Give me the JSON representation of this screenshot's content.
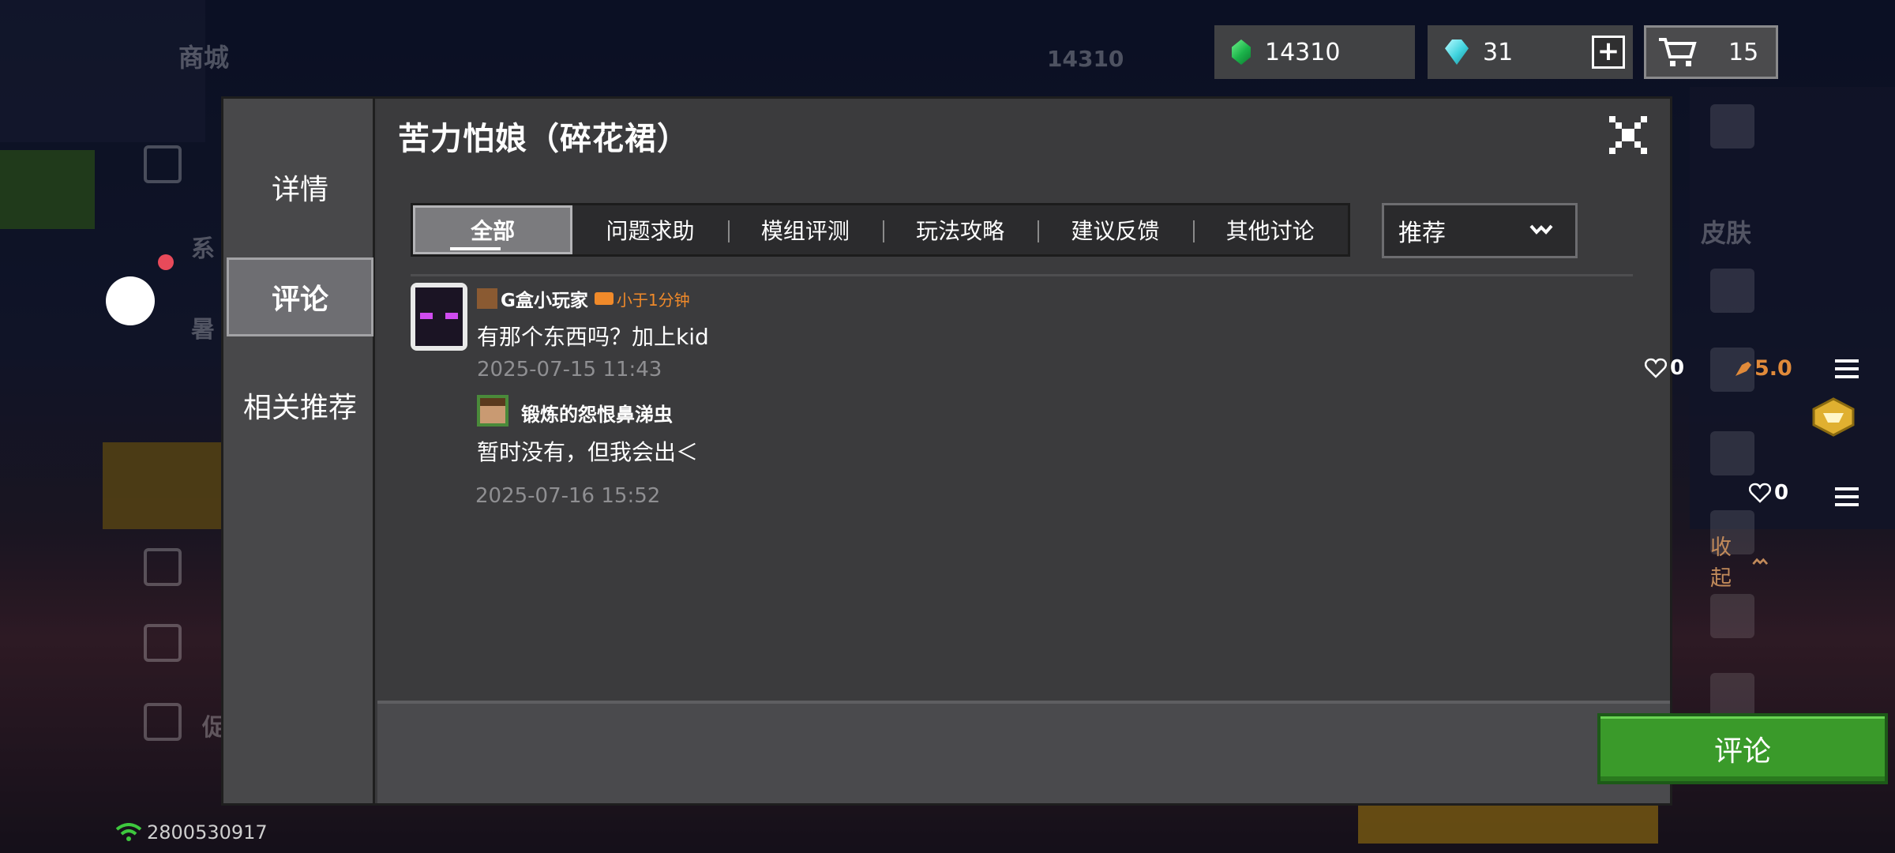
{
  "background": {
    "shop_label": "商城",
    "shop_balance": "14310",
    "left_labels": [
      "系",
      "暑",
      "促"
    ],
    "right_label": "皮肤"
  },
  "currency": {
    "emerald": "14310",
    "diamond": "31",
    "cart_count": "15",
    "plus_label": "+"
  },
  "dialog": {
    "title": "苦力怕娘（碎花裙）",
    "sidebar": [
      "详情",
      "评论",
      "相关推荐"
    ],
    "active_sidebar": "评论",
    "tabs": [
      "全部",
      "问题求助",
      "模组评测",
      "玩法攻略",
      "建议反馈",
      "其他讨论"
    ],
    "active_tab": "全部",
    "sort": {
      "value": "推荐"
    },
    "comment": {
      "username": "G盒小玩家",
      "time_flag": "小于1分钟",
      "text": "有那个东西吗？加上kid",
      "date": "2025-07-15 11:43",
      "likes": "0",
      "rating": "5.0"
    },
    "reply": {
      "username": "锻炼的怨恨鼻涕虫",
      "text": "暂时没有，但我会出＜",
      "date": "2025-07-16 15:52",
      "likes": "0"
    },
    "collapse_label": "收起",
    "comment_button": "评论"
  },
  "status": {
    "network_id": "2800530917"
  },
  "colors": {
    "accent_green": "#3a9a2a",
    "rating_orange": "#e08a3a",
    "time_orange": "#f08a2a"
  }
}
